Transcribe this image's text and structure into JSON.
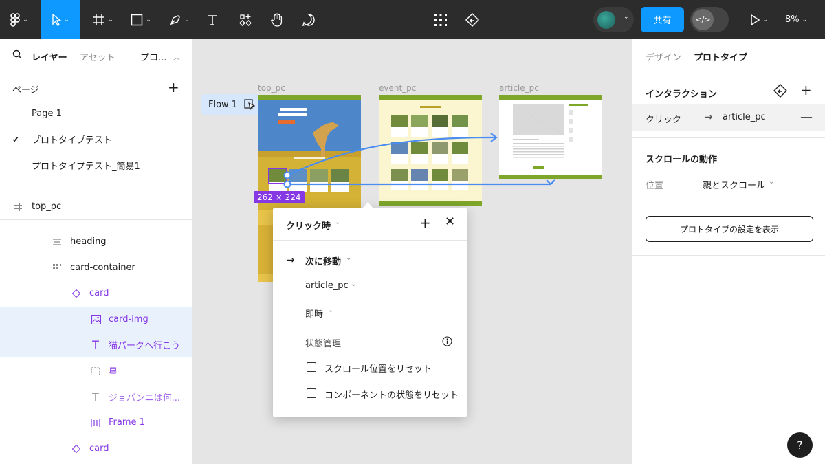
{
  "toolbar": {
    "share_label": "共有",
    "zoom_label": "8%",
    "dev_label": "</>"
  },
  "left_panel": {
    "tabs": [
      {
        "label": "レイヤー"
      },
      {
        "label": "アセット"
      },
      {
        "label": "プロ..."
      }
    ],
    "pages_title": "ページ",
    "pages": [
      {
        "label": "Page 1"
      },
      {
        "label": "プロトタイプテスト"
      },
      {
        "label": "プロトタイプテスト_簡易1"
      }
    ],
    "frame_name": "top_pc",
    "layers": [
      {
        "label": "heading"
      },
      {
        "label": "card-container"
      },
      {
        "label": "card"
      },
      {
        "label": "card-img"
      },
      {
        "label": "猫パークへ行こう"
      },
      {
        "label": "星"
      },
      {
        "label": "ジョバンニは何..."
      },
      {
        "label": "Frame 1"
      },
      {
        "label": "card"
      }
    ]
  },
  "canvas": {
    "frames": [
      {
        "label": "top_pc"
      },
      {
        "label": "event_pc"
      },
      {
        "label": "article_pc"
      }
    ],
    "flow_label": "Flow 1",
    "size_label": "262 × 224"
  },
  "popup": {
    "trigger": "クリック時",
    "action": "次に移動",
    "destination": "article_pc",
    "animation": "即時",
    "state_title": "状態管理",
    "reset_scroll": "スクロール位置をリセット",
    "reset_component": "コンポーネントの状態をリセット"
  },
  "right_panel": {
    "tabs": [
      {
        "label": "デザイン"
      },
      {
        "label": "プロトタイプ"
      }
    ],
    "interaction_title": "インタラクション",
    "interaction_trigger": "クリック",
    "interaction_target": "article_pc",
    "scroll_title": "スクロールの動作",
    "position_label": "位置",
    "position_value": "親とスクロール",
    "settings_button": "プロトタイプの設定を表示"
  },
  "colors": {
    "toolbar_bg": "#2c2c2c",
    "accent": "#0d99ff",
    "selection": "#8638e5",
    "frame_green": "#7ea72a"
  },
  "help_label": "?"
}
